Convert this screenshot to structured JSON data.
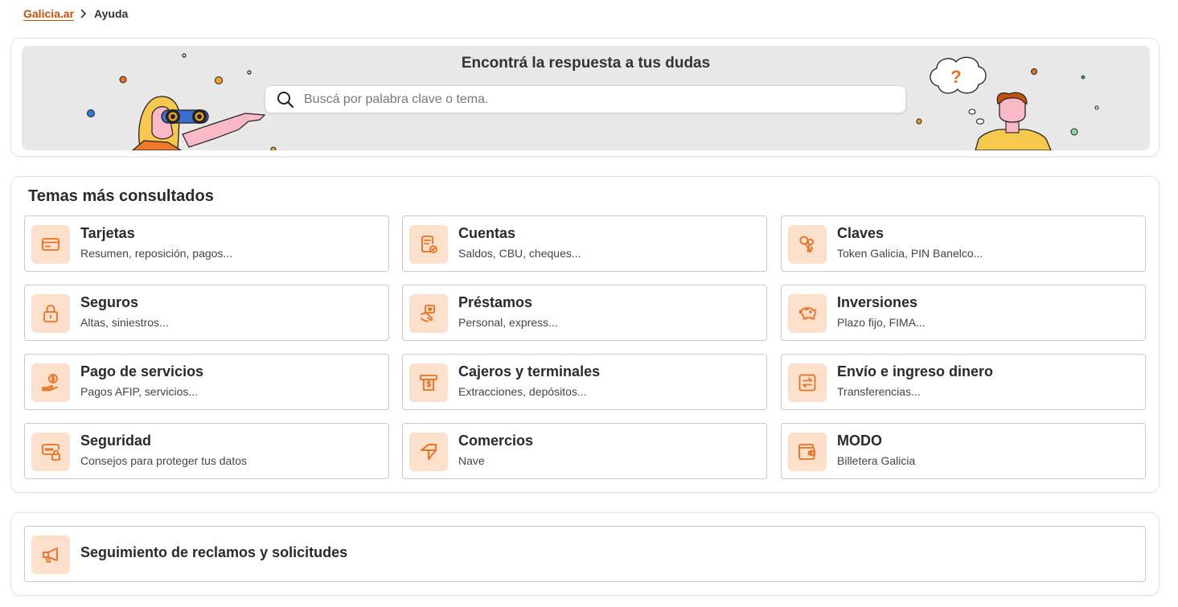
{
  "breadcrumb": {
    "home": "Galicia.ar",
    "current": "Ayuda"
  },
  "hero": {
    "title": "Encontrá la respuesta a tus dudas",
    "search_placeholder": "Buscá por palabra clave o tema.",
    "question_mark": "?"
  },
  "topics": {
    "title": "Temas más consultados",
    "items": [
      {
        "title": "Tarjetas",
        "desc": "Resumen, reposición, pagos...",
        "icon": "credit-card-icon"
      },
      {
        "title": "Cuentas",
        "desc": "Saldos, CBU, cheques...",
        "icon": "account-document-icon"
      },
      {
        "title": "Claves",
        "desc": "Token Galicia, PIN Banelco...",
        "icon": "keys-icon"
      },
      {
        "title": "Seguros",
        "desc": "Altas, siniestros...",
        "icon": "lock-icon"
      },
      {
        "title": "Préstamos",
        "desc": "Personal, express...",
        "icon": "loan-hand-icon"
      },
      {
        "title": "Inversiones",
        "desc": "Plazo fijo, FIMA...",
        "icon": "piggy-bank-icon"
      },
      {
        "title": "Pago de servicios",
        "desc": "Pagos AFIP, servicios...",
        "icon": "payment-hand-icon"
      },
      {
        "title": "Cajeros y terminales",
        "desc": "Extracciones, depósitos...",
        "icon": "atm-cash-icon"
      },
      {
        "title": "Envío e ingreso dinero",
        "desc": "Transferencias...",
        "icon": "transfer-icon"
      },
      {
        "title": "Seguridad",
        "desc": "Consejos para proteger tus datos",
        "icon": "security-password-icon"
      },
      {
        "title": "Comercios",
        "desc": "Nave",
        "icon": "nave-icon"
      },
      {
        "title": "MODO",
        "desc": "Billetera Galicia",
        "icon": "wallet-icon"
      }
    ]
  },
  "claims": {
    "title": "Seguimiento de reclamos y solicitudes",
    "icon": "megaphone-icon"
  },
  "colors": {
    "accent": "#c2520a",
    "icon_orange": "#e8701f",
    "tile_bg": "#fde0cc",
    "hero_bg": "#e8e8e8"
  }
}
